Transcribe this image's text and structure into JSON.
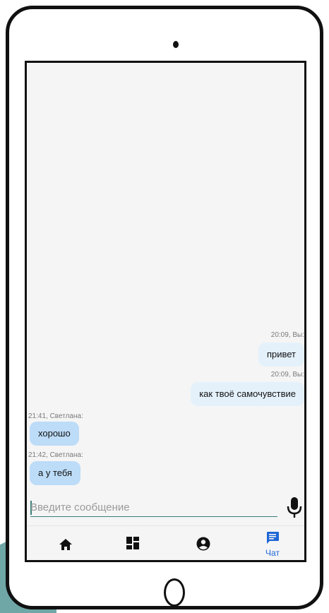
{
  "chat": {
    "messages": [
      {
        "meta": "20:09, Вы:",
        "text": "привет",
        "direction": "out"
      },
      {
        "meta": "20:09, Вы:",
        "text": "как твоё самочувствие",
        "direction": "out"
      },
      {
        "meta": "21:41, Светлана:",
        "text": "хорошо",
        "direction": "in"
      },
      {
        "meta": "21:42, Светлана:",
        "text": "а у тебя",
        "direction": "in"
      }
    ]
  },
  "composer": {
    "placeholder": "Введите сообщение",
    "value": "",
    "mic_icon": "microphone-icon"
  },
  "nav": {
    "items": [
      {
        "icon": "home-icon",
        "label": "",
        "active": false
      },
      {
        "icon": "dashboard-icon",
        "label": "",
        "active": false
      },
      {
        "icon": "account-circle-icon",
        "label": "",
        "active": false
      },
      {
        "icon": "chat-icon",
        "label": "Чат",
        "active": true
      }
    ]
  },
  "colors": {
    "accent": "#1f66d6",
    "outgoing_bubble": "#e4f1fb",
    "incoming_bubble": "#bcdcf8",
    "input_underline": "#3a7f7a"
  }
}
